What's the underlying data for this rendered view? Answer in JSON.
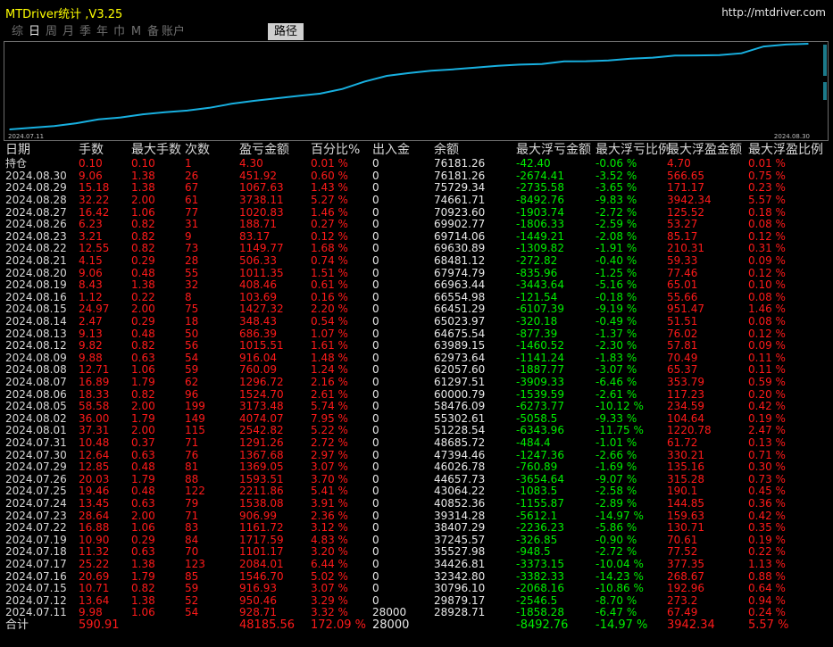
{
  "app": {
    "title": "MTDriver统计 ,V3.25",
    "url": "http://mtdriver.com"
  },
  "tabs": [
    "综",
    "日",
    "周",
    "月",
    "季",
    "年",
    "巾",
    "M",
    "备",
    "账户"
  ],
  "active_tab": "日",
  "path_tab": "路径",
  "chart_data": {
    "type": "line",
    "title": "",
    "xlabel": "",
    "ylabel": "",
    "x_start_label": "2024.07.11",
    "x_end_label": "2024.08.30",
    "line_color": "#18b0e0",
    "x": [
      "2024.07.11",
      "2024.07.12",
      "2024.07.15",
      "2024.07.16",
      "2024.07.17",
      "2024.07.18",
      "2024.07.19",
      "2024.07.22",
      "2024.07.23",
      "2024.07.24",
      "2024.07.25",
      "2024.07.26",
      "2024.07.29",
      "2024.07.30",
      "2024.07.31",
      "2024.08.01",
      "2024.08.02",
      "2024.08.05",
      "2024.08.06",
      "2024.08.07",
      "2024.08.08",
      "2024.08.09",
      "2024.08.12",
      "2024.08.13",
      "2024.08.14",
      "2024.08.15",
      "2024.08.16",
      "2024.08.19",
      "2024.08.20",
      "2024.08.21",
      "2024.08.22",
      "2024.08.23",
      "2024.08.26",
      "2024.08.27",
      "2024.08.28",
      "2024.08.29",
      "2024.08.30"
    ],
    "y": [
      28928.71,
      29879.17,
      30796.1,
      32342.8,
      34426.81,
      35527.98,
      37245.57,
      38407.29,
      39314.28,
      40852.36,
      43064.22,
      44657.73,
      46026.78,
      47394.46,
      48685.72,
      51228.54,
      55302.61,
      58476.09,
      60000.79,
      61297.51,
      62057.6,
      62973.64,
      63989.15,
      64675.54,
      65023.97,
      66451.29,
      66554.98,
      66963.44,
      67974.79,
      68481.12,
      69630.89,
      69714.06,
      69902.77,
      70923.6,
      74661.71,
      75729.34,
      76181.26
    ]
  },
  "table": {
    "headers": [
      "日期",
      "手数",
      "最大手数",
      "次数",
      "盈亏金额",
      "百分比%",
      "出入金",
      "余额",
      "最大浮亏金额",
      "最大浮亏比例",
      "最大浮盈金额",
      "最大浮盈比例"
    ],
    "holding": [
      "持仓",
      "0.10",
      "0.10",
      "1",
      "4.30",
      "0.01 %",
      "0",
      "76181.26",
      "-42.40",
      "-0.06 %",
      "4.70",
      "0.01 %"
    ],
    "rows": [
      [
        "2024.08.30",
        "9.06",
        "1.38",
        "26",
        "451.92",
        "0.60 %",
        "0",
        "76181.26",
        "-2674.41",
        "-3.52 %",
        "566.65",
        "0.75 %"
      ],
      [
        "2024.08.29",
        "15.18",
        "1.38",
        "67",
        "1067.63",
        "1.43 %",
        "0",
        "75729.34",
        "-2735.58",
        "-3.65 %",
        "171.17",
        "0.23 %"
      ],
      [
        "2024.08.28",
        "32.22",
        "2.00",
        "61",
        "3738.11",
        "5.27 %",
        "0",
        "74661.71",
        "-8492.76",
        "-9.83 %",
        "3942.34",
        "5.57 %"
      ],
      [
        "2024.08.27",
        "16.42",
        "1.06",
        "77",
        "1020.83",
        "1.46 %",
        "0",
        "70923.60",
        "-1903.74",
        "-2.72 %",
        "125.52",
        "0.18 %"
      ],
      [
        "2024.08.26",
        "6.23",
        "0.82",
        "31",
        "188.71",
        "0.27 %",
        "0",
        "69902.77",
        "-1806.33",
        "-2.59 %",
        "53.27",
        "0.08 %"
      ],
      [
        "2024.08.23",
        "3.21",
        "0.82",
        "9",
        "83.17",
        "0.12 %",
        "0",
        "69714.06",
        "-1449.21",
        "-2.08 %",
        "85.17",
        "0.12 %"
      ],
      [
        "2024.08.22",
        "12.55",
        "0.82",
        "73",
        "1149.77",
        "1.68 %",
        "0",
        "69630.89",
        "-1309.82",
        "-1.91 %",
        "210.31",
        "0.31 %"
      ],
      [
        "2024.08.21",
        "4.15",
        "0.29",
        "28",
        "506.33",
        "0.74 %",
        "0",
        "68481.12",
        "-272.82",
        "-0.40 %",
        "59.33",
        "0.09 %"
      ],
      [
        "2024.08.20",
        "9.06",
        "0.48",
        "55",
        "1011.35",
        "1.51 %",
        "0",
        "67974.79",
        "-835.96",
        "-1.25 %",
        "77.46",
        "0.12 %"
      ],
      [
        "2024.08.19",
        "8.43",
        "1.38",
        "32",
        "408.46",
        "0.61 %",
        "0",
        "66963.44",
        "-3443.64",
        "-5.16 %",
        "65.01",
        "0.10 %"
      ],
      [
        "2024.08.16",
        "1.12",
        "0.22",
        "8",
        "103.69",
        "0.16 %",
        "0",
        "66554.98",
        "-121.54",
        "-0.18 %",
        "55.66",
        "0.08 %"
      ],
      [
        "2024.08.15",
        "24.97",
        "2.00",
        "75",
        "1427.32",
        "2.20 %",
        "0",
        "66451.29",
        "-6107.39",
        "-9.19 %",
        "951.47",
        "1.46 %"
      ],
      [
        "2024.08.14",
        "2.47",
        "0.29",
        "18",
        "348.43",
        "0.54 %",
        "0",
        "65023.97",
        "-320.18",
        "-0.49 %",
        "51.51",
        "0.08 %"
      ],
      [
        "2024.08.13",
        "9.13",
        "0.48",
        "50",
        "686.39",
        "1.07 %",
        "0",
        "64675.54",
        "-877.39",
        "-1.37 %",
        "76.02",
        "0.12 %"
      ],
      [
        "2024.08.12",
        "9.82",
        "0.82",
        "56",
        "1015.51",
        "1.61 %",
        "0",
        "63989.15",
        "-1460.52",
        "-2.30 %",
        "57.81",
        "0.09 %"
      ],
      [
        "2024.08.09",
        "9.88",
        "0.63",
        "54",
        "916.04",
        "1.48 %",
        "0",
        "62973.64",
        "-1141.24",
        "-1.83 %",
        "70.49",
        "0.11 %"
      ],
      [
        "2024.08.08",
        "12.71",
        "1.06",
        "59",
        "760.09",
        "1.24 %",
        "0",
        "62057.60",
        "-1887.77",
        "-3.07 %",
        "65.37",
        "0.11 %"
      ],
      [
        "2024.08.07",
        "16.89",
        "1.79",
        "62",
        "1296.72",
        "2.16 %",
        "0",
        "61297.51",
        "-3909.33",
        "-6.46 %",
        "353.79",
        "0.59 %"
      ],
      [
        "2024.08.06",
        "18.33",
        "0.82",
        "96",
        "1524.70",
        "2.61 %",
        "0",
        "60000.79",
        "-1539.59",
        "-2.61 %",
        "117.23",
        "0.20 %"
      ],
      [
        "2024.08.05",
        "58.58",
        "2.00",
        "199",
        "3173.48",
        "5.74 %",
        "0",
        "58476.09",
        "-6273.77",
        "-10.12 %",
        "234.59",
        "0.42 %"
      ],
      [
        "2024.08.02",
        "36.00",
        "1.79",
        "149",
        "4074.07",
        "7.95 %",
        "0",
        "55302.61",
        "-5058.5",
        "-9.33 %",
        "104.64",
        "0.19 %"
      ],
      [
        "2024.08.01",
        "37.31",
        "2.00",
        "115",
        "2542.82",
        "5.22 %",
        "0",
        "51228.54",
        "-6343.96",
        "-11.75 %",
        "1220.78",
        "2.47 %"
      ],
      [
        "2024.07.31",
        "10.48",
        "0.37",
        "71",
        "1291.26",
        "2.72 %",
        "0",
        "48685.72",
        "-484.4",
        "-1.01 %",
        "61.72",
        "0.13 %"
      ],
      [
        "2024.07.30",
        "12.64",
        "0.63",
        "76",
        "1367.68",
        "2.97 %",
        "0",
        "47394.46",
        "-1247.36",
        "-2.66 %",
        "330.21",
        "0.71 %"
      ],
      [
        "2024.07.29",
        "12.85",
        "0.48",
        "81",
        "1369.05",
        "3.07 %",
        "0",
        "46026.78",
        "-760.89",
        "-1.69 %",
        "135.16",
        "0.30 %"
      ],
      [
        "2024.07.26",
        "20.03",
        "1.79",
        "88",
        "1593.51",
        "3.70 %",
        "0",
        "44657.73",
        "-3654.64",
        "-9.07 %",
        "315.28",
        "0.73 %"
      ],
      [
        "2024.07.25",
        "19.46",
        "0.48",
        "122",
        "2211.86",
        "5.41 %",
        "0",
        "43064.22",
        "-1083.5",
        "-2.58 %",
        "190.1",
        "0.45 %"
      ],
      [
        "2024.07.24",
        "13.45",
        "0.63",
        "79",
        "1538.08",
        "3.91 %",
        "0",
        "40852.36",
        "-1155.87",
        "-2.89 %",
        "144.85",
        "0.36 %"
      ],
      [
        "2024.07.23",
        "28.64",
        "2.00",
        "71",
        "906.99",
        "2.36 %",
        "0",
        "39314.28",
        "-5612.1",
        "-14.97 %",
        "159.63",
        "0.42 %"
      ],
      [
        "2024.07.22",
        "16.88",
        "1.06",
        "83",
        "1161.72",
        "3.12 %",
        "0",
        "38407.29",
        "-2236.23",
        "-5.86 %",
        "130.71",
        "0.35 %"
      ],
      [
        "2024.07.19",
        "10.90",
        "0.29",
        "84",
        "1717.59",
        "4.83 %",
        "0",
        "37245.57",
        "-326.85",
        "-0.90 %",
        "70.61",
        "0.19 %"
      ],
      [
        "2024.07.18",
        "11.32",
        "0.63",
        "70",
        "1101.17",
        "3.20 %",
        "0",
        "35527.98",
        "-948.5",
        "-2.72 %",
        "77.52",
        "0.22 %"
      ],
      [
        "2024.07.17",
        "25.22",
        "1.38",
        "123",
        "2084.01",
        "6.44 %",
        "0",
        "34426.81",
        "-3373.15",
        "-10.04 %",
        "377.35",
        "1.13 %"
      ],
      [
        "2024.07.16",
        "20.69",
        "1.79",
        "85",
        "1546.70",
        "5.02 %",
        "0",
        "32342.80",
        "-3382.33",
        "-14.23 %",
        "268.67",
        "0.88 %"
      ],
      [
        "2024.07.15",
        "10.71",
        "0.82",
        "59",
        "916.93",
        "3.07 %",
        "0",
        "30796.10",
        "-2068.16",
        "-10.86 %",
        "192.96",
        "0.64 %"
      ],
      [
        "2024.07.12",
        "13.64",
        "1.38",
        "52",
        "950.46",
        "3.29 %",
        "0",
        "29879.17",
        "-2546.5",
        "-8.70 %",
        "273.2",
        "0.94 %"
      ],
      [
        "2024.07.11",
        "9.98",
        "1.06",
        "54",
        "928.71",
        "3.32 %",
        "28000",
        "28928.71",
        "-1858.28",
        "-6.47 %",
        "67.49",
        "0.24 %"
      ]
    ],
    "total": [
      "合计",
      "590.91",
      "",
      "",
      "48185.56",
      "172.09 %",
      "28000",
      "",
      "-8492.76",
      "-14.97 %",
      "3942.34",
      "5.57 %"
    ]
  },
  "colors": {
    "background": "#000000",
    "title": "#ffff00",
    "profit": "#ff1a1a",
    "loss": "#00ee00",
    "neutral": "#e8e8e8"
  }
}
